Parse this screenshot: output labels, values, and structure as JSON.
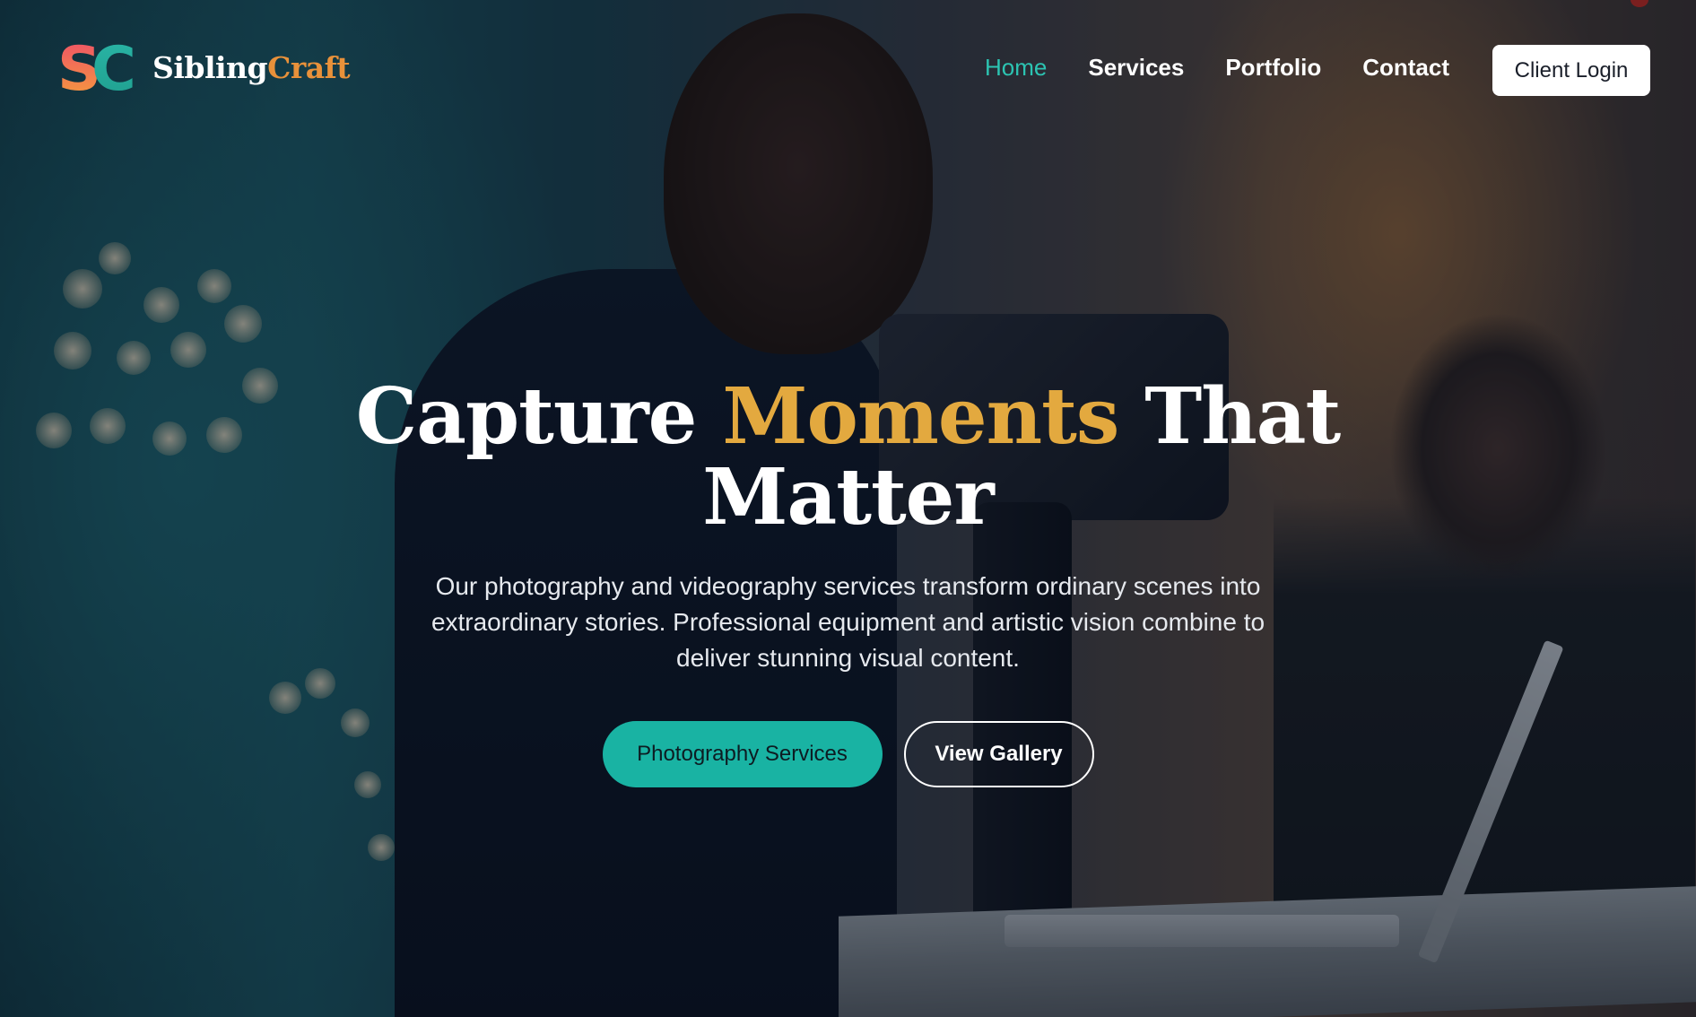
{
  "brand": {
    "mark": "SC",
    "name_part1": "Sibling",
    "name_part2": "Craft",
    "colors": {
      "mark_s": "#f06a3a",
      "mark_c": "#22b39f",
      "name_accent": "#e8913a"
    }
  },
  "nav": {
    "items": [
      {
        "label": "Home",
        "active": true
      },
      {
        "label": "Services",
        "active": false
      },
      {
        "label": "Portfolio",
        "active": false
      },
      {
        "label": "Contact",
        "active": false
      }
    ],
    "login_label": "Client Login",
    "active_color": "#2cc4b2"
  },
  "hero": {
    "title_part1": "Capture ",
    "title_accent": "Moments",
    "title_part2": " That",
    "title_line2": "Matter",
    "accent_color": "#e3a93f",
    "subtitle": "Our photography and videography services transform ordinary scenes into extraordinary stories. Professional equipment and artistic vision combine to deliver stunning visual content.",
    "primary_cta": "Photography Services",
    "secondary_cta": "View Gallery",
    "primary_color": "#19b3a3",
    "background_image": "videographer-with-camera-rig-icon"
  }
}
